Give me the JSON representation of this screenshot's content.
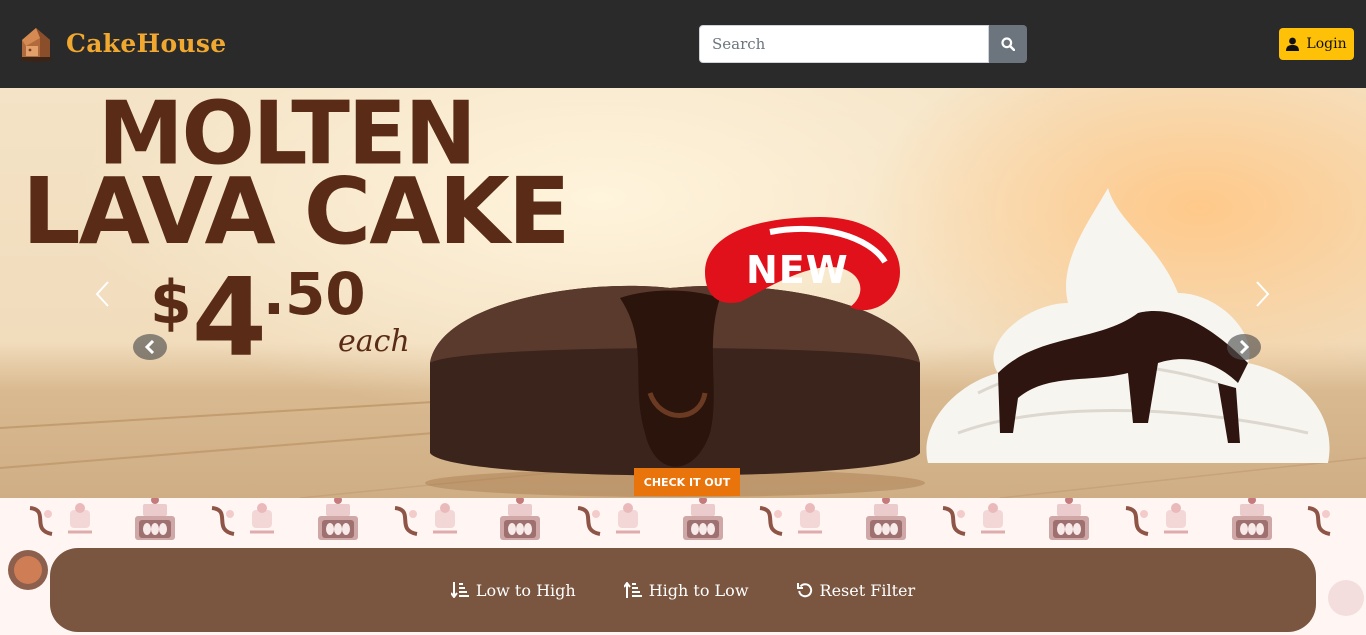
{
  "navbar": {
    "brand": "CakeHouse",
    "search_placeholder": "Search",
    "search_value": "",
    "login_label": "Login"
  },
  "carousel": {
    "promo_line1": "MOLTEN",
    "promo_line2": "LAVA CAKE",
    "price_dollar": "$",
    "price_int": "4",
    "price_dec": ".50",
    "price_unit": "each",
    "badge": "NEW",
    "cta_label": "CHECK IT OUT"
  },
  "filters": {
    "low_to_high": "Low to High",
    "high_to_low": "High to Low",
    "reset": "Reset Filter"
  },
  "colors": {
    "navbar_bg": "#2a2a2a",
    "brand": "#f0a830",
    "login_btn": "#ffc107",
    "search_btn": "#6c757d",
    "filter_bar": "#7a5640",
    "cta": "#e8740b",
    "badge": "#e0111a"
  }
}
